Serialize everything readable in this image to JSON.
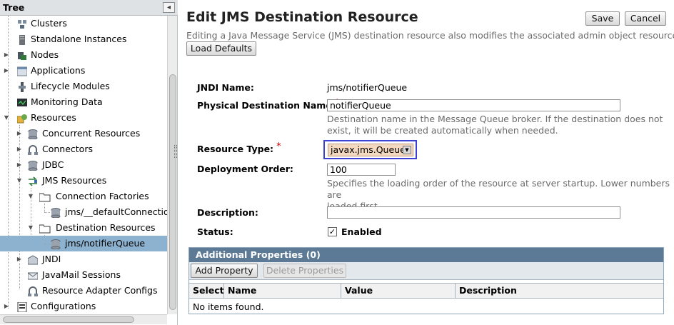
{
  "tree": {
    "title": "Tree",
    "collapse_glyph": "◂",
    "items": [
      {
        "label": "Clusters",
        "icon": "cluster-icon"
      },
      {
        "label": "Standalone Instances",
        "icon": "server-icon"
      },
      {
        "label": "Nodes",
        "icon": "node-icon"
      },
      {
        "label": "Applications",
        "icon": "applications-icon"
      },
      {
        "label": "Lifecycle Modules",
        "icon": "lifecycle-icon"
      },
      {
        "label": "Monitoring Data",
        "icon": "monitor-icon"
      },
      {
        "label": "Resources",
        "icon": "resources-icon"
      },
      {
        "label": "Concurrent Resources",
        "icon": "database-icon"
      },
      {
        "label": "Connectors",
        "icon": "connector-icon"
      },
      {
        "label": "JDBC",
        "icon": "database-icon"
      },
      {
        "label": "JMS Resources",
        "icon": "jms-icon"
      },
      {
        "label": "Connection Factories",
        "icon": "folder-icon"
      },
      {
        "label": "jms/__defaultConnection",
        "icon": "database-icon"
      },
      {
        "label": "Destination Resources",
        "icon": "folder-icon"
      },
      {
        "label": "jms/notifierQueue",
        "icon": "database-icon"
      },
      {
        "label": "JNDI",
        "icon": "jndi-icon"
      },
      {
        "label": "JavaMail Sessions",
        "icon": "mail-icon"
      },
      {
        "label": "Resource Adapter Configs",
        "icon": "connector-icon"
      },
      {
        "label": "Configurations",
        "icon": "configurations-icon"
      }
    ]
  },
  "page": {
    "title": "Edit JMS Destination Resource",
    "help": "Editing a Java Message Service (JMS) destination resource also modifies the associated admin object resource.",
    "save_label": "Save",
    "cancel_label": "Cancel",
    "load_defaults_label": "Load Defaults"
  },
  "form": {
    "jndi_label": "JNDI Name:",
    "jndi_value": "jms/notifierQueue",
    "physdest_label": "Physical Destination Name",
    "physdest_value": "notifierQueue",
    "physdest_help_1": "Destination name in the Message Queue broker. If the destination does not",
    "physdest_help_2": "exist, it will be created automatically when needed.",
    "restype_label": "Resource Type:",
    "restype_value": "javax.jms.Queue",
    "order_label": "Deployment Order:",
    "order_value": "100",
    "order_help_1": "Specifies the loading order of the resource at server startup. Lower numbers are",
    "order_help_2": "loaded first.",
    "description_label": "Description:",
    "description_value": "",
    "status_label": "Status:",
    "enabled_label": "Enabled",
    "enabled_checked": true,
    "required_mark": "*"
  },
  "additional_properties": {
    "title": "Additional Properties (0)",
    "add_label": "Add Property",
    "delete_label": "Delete Properties",
    "columns": [
      "Select",
      "Name",
      "Value",
      "Description"
    ],
    "empty_text": "No items found."
  },
  "colors": {
    "selected_row": "#8db2cf",
    "table_header": "#5c7a96",
    "highlight_border": "#3c3fd3",
    "required": "#cc0000"
  }
}
